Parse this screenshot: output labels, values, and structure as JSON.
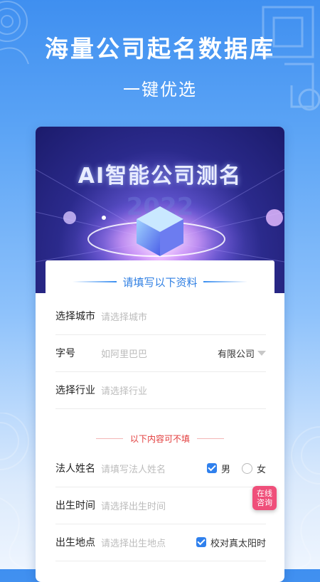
{
  "hero": {
    "title": "海量公司起名数据库",
    "subtitle": "一键优选"
  },
  "banner": {
    "title": "AI智能公司测名",
    "year_watermark": "2022"
  },
  "form": {
    "section_title": "请填写以下资料",
    "fields": {
      "city": {
        "label": "选择城市",
        "placeholder": "请选择城市"
      },
      "name": {
        "label": "字号",
        "placeholder": "如阿里巴巴",
        "suffix": "有限公司"
      },
      "industry": {
        "label": "选择行业",
        "placeholder": "请选择行业"
      }
    },
    "optional_note": "以下内容可不填",
    "optional_fields": {
      "legal_person": {
        "label": "法人姓名",
        "placeholder": "请填写法人姓名"
      },
      "gender": {
        "male": "男",
        "female": "女",
        "selected": "男"
      },
      "birth_time": {
        "label": "出生时间",
        "placeholder": "请选择出生时间"
      },
      "birth_place": {
        "label": "出生地点",
        "placeholder": "请选择出生地点",
        "solar_check_label": "校对真太阳时",
        "solar_checked": true
      }
    }
  },
  "consult_button": {
    "line1": "在线",
    "line2": "咨询"
  },
  "colors": {
    "accent": "#2f80ed",
    "note_red": "#e23a3a",
    "consult_pink": "#ef4f7a"
  }
}
